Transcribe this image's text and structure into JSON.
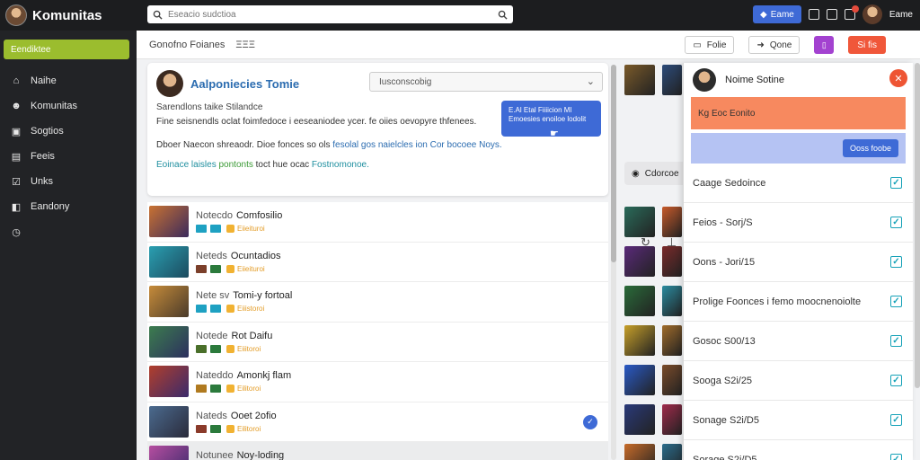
{
  "app": {
    "title": "Komunitas"
  },
  "search": {
    "placeholder": "Eseacio sudctioa"
  },
  "topbar": {
    "button_label": "Eame",
    "user_name": "Eame"
  },
  "sidebar": {
    "active_label": "Eendiktee",
    "items": [
      {
        "label": "Naihe",
        "icon": "home-icon"
      },
      {
        "label": "Komunitas",
        "icon": "people-icon"
      },
      {
        "label": "Sogtios",
        "icon": "briefcase-icon"
      },
      {
        "label": "Feeis",
        "icon": "feed-icon"
      },
      {
        "label": "Unks",
        "icon": "link-icon"
      },
      {
        "label": "Eandony",
        "icon": "cube-icon"
      },
      {
        "label": "",
        "icon": "clock-icon"
      }
    ]
  },
  "header": {
    "breadcrumb": [
      "Gonofno Foianes",
      "ΞΞΞ"
    ],
    "btn_one": "Folie",
    "btn_two": "Qone",
    "btn_red": "Si fis"
  },
  "community": {
    "title": "Aalponiecies Tomie",
    "select_value": "Iusconscobig",
    "subtitle": "Sarendlons taike Stilandce",
    "description": "Fine seisnendls oclat foimfedoce i eeseaniodee ycer. fe oiies oevopyre thfenees.",
    "line2_a": "Dboer Naecon shreaodr. Dioe fonces so ols",
    "line2_b": "fesolal gos naielcles ion Cor bocoee Noys.",
    "line3_a": "Eoinace laisles",
    "line3_b": "pontonts",
    "line3_c": "toct hue ocac",
    "line3_d": "Fostnomonoe.",
    "promo": "E.Al Etal Fiiiicion Ml  Emoesies enoiloe lodolit"
  },
  "rows": [
    {
      "prefix": "Notecdo",
      "name": "Comfosilio",
      "tag": "Eiieituroi",
      "colors": [
        "#c97232",
        "#3b2a5c"
      ],
      "sq": [
        "#1ea1c2",
        "#1ea1c2"
      ],
      "checked": false
    },
    {
      "prefix": "Neteds",
      "name": "Ocuntadios",
      "tag": "Eiieituroi",
      "colors": [
        "#2a9fb1",
        "#1c4a5e"
      ],
      "sq": [
        "#7b3f2a",
        "#2b7a3c"
      ],
      "checked": false
    },
    {
      "prefix": "Nete sv",
      "name": "Tomi-y fortoal",
      "tag": "Eiiistoroi",
      "colors": [
        "#c68b3a",
        "#4a3b2a"
      ],
      "sq": [
        "#1ea1c2",
        "#1ea1c2"
      ],
      "checked": false
    },
    {
      "prefix": "Notede",
      "name": "Rot Daifu",
      "tag": "Eiiitoroi",
      "colors": [
        "#3c7d4e",
        "#2c2f5e"
      ],
      "sq": [
        "#4a6f2a",
        "#2b7a3c"
      ],
      "checked": false
    },
    {
      "prefix": "Nateddo",
      "name": "Amonkj flam",
      "tag": "Eilitoroi",
      "colors": [
        "#b13f2c",
        "#3a2a6b"
      ],
      "sq": [
        "#b07a1f",
        "#2b7a3c"
      ],
      "checked": false
    },
    {
      "prefix": "Nateds",
      "name": "Ooet 2ofio",
      "tag": "Eilitoroi",
      "colors": [
        "#4b6b8f",
        "#2a2a3a"
      ],
      "sq": [
        "#8a3a2a",
        "#2b7a3c"
      ],
      "checked": true
    },
    {
      "prefix": "Notunee",
      "name": "Noy-loding",
      "tag": "",
      "colors": [
        "#b64ea0",
        "#3a2a6b"
      ],
      "sq": [
        "#1ea1c2",
        "#1ea1c2"
      ],
      "checked": false
    }
  ],
  "media": {
    "pill_label": "Cdorcoe",
    "tiles": [
      "#7a5a2a",
      "#2c4b7a",
      "#2a6b5a",
      "#c75a2a",
      "#5a2a7a",
      "#7a2a2a",
      "#2a6b3a",
      "#2a8ba0",
      "#c7a02a",
      "#a06b2a",
      "#2a5ac7",
      "#7a4b2a",
      "#2a3a7a",
      "#a02a4b",
      "#c76b2a",
      "#2a6b8b"
    ]
  },
  "panel": {
    "title": "Noime Sotine",
    "orange_text": "Kg Eoc Eonito",
    "button": "Ooss foobe",
    "items": [
      "Caage Sedoince",
      "Feios - Sorj/S",
      "Oons - Jori/15",
      "Prolige Foonces i femo moocnenoiolte",
      "Gosoc S00/13",
      "Sooga S2i/25",
      "Sonage S2i/D5",
      "Sorage S2i/D5"
    ]
  }
}
